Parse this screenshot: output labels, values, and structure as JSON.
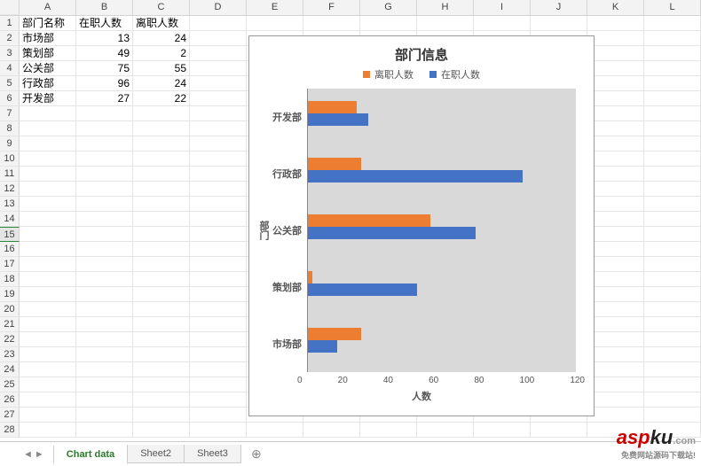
{
  "columns": [
    "A",
    "B",
    "C",
    "D",
    "E",
    "F",
    "G",
    "H",
    "I",
    "J",
    "K",
    "L"
  ],
  "row_count": 28,
  "selected_row": 15,
  "table": {
    "headers": [
      "部门名称",
      "在职人数",
      "离职人数"
    ],
    "rows": [
      {
        "dept": "市场部",
        "on": 13,
        "off": 24
      },
      {
        "dept": "策划部",
        "on": 49,
        "off": 2
      },
      {
        "dept": "公关部",
        "on": 75,
        "off": 55
      },
      {
        "dept": "行政部",
        "on": 96,
        "off": 24
      },
      {
        "dept": "开发部",
        "on": 27,
        "off": 22
      }
    ]
  },
  "chart_data": {
    "type": "bar",
    "orientation": "horizontal",
    "title": "部门信息",
    "xlabel": "人数",
    "ylabel": "部门",
    "categories": [
      "市场部",
      "策划部",
      "公关部",
      "行政部",
      "开发部"
    ],
    "series": [
      {
        "name": "离职人数",
        "color": "#ed7d31",
        "values": [
          24,
          2,
          55,
          24,
          22
        ]
      },
      {
        "name": "在职人数",
        "color": "#4472c4",
        "values": [
          13,
          49,
          75,
          96,
          27
        ]
      }
    ],
    "xlim": [
      0,
      120
    ],
    "xticks": [
      0,
      20,
      40,
      60,
      80,
      100,
      120
    ]
  },
  "tabs": {
    "items": [
      "Chart data",
      "Sheet2",
      "Sheet3"
    ],
    "active": 0
  },
  "watermark": {
    "a": "asp",
    "b": "ku",
    "c": ".com",
    "sub": "免费网站源码下载站!"
  }
}
